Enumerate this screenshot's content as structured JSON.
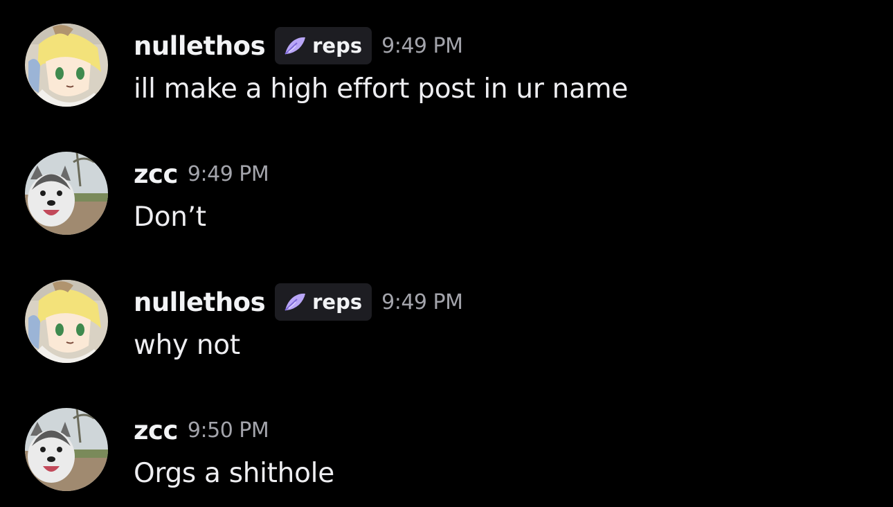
{
  "messages": [
    {
      "author": "nullethos",
      "avatar_icon": "anime-character-avatar-icon",
      "tag": {
        "icon": "purple-feather-icon",
        "label": "reps",
        "color": "#b9a6f7"
      },
      "timestamp": "9:49 PM",
      "text": "ill make a high effort post in ur name"
    },
    {
      "author": "zcc",
      "avatar_icon": "husky-dog-avatar-icon",
      "timestamp": "9:49 PM",
      "text": "Don’t"
    },
    {
      "author": "nullethos",
      "avatar_icon": "anime-character-avatar-icon",
      "tag": {
        "icon": "purple-feather-icon",
        "label": "reps",
        "color": "#b9a6f7"
      },
      "timestamp": "9:49 PM",
      "text": "why not"
    },
    {
      "author": "zcc",
      "avatar_icon": "husky-dog-avatar-icon",
      "timestamp": "9:50 PM",
      "text": "Orgs a shithole"
    }
  ],
  "theme": {
    "background": "#000000",
    "username_color": "#f2f3f5",
    "timestamp_color": "#a3a4ab",
    "tag_background": "#1d1d22"
  }
}
